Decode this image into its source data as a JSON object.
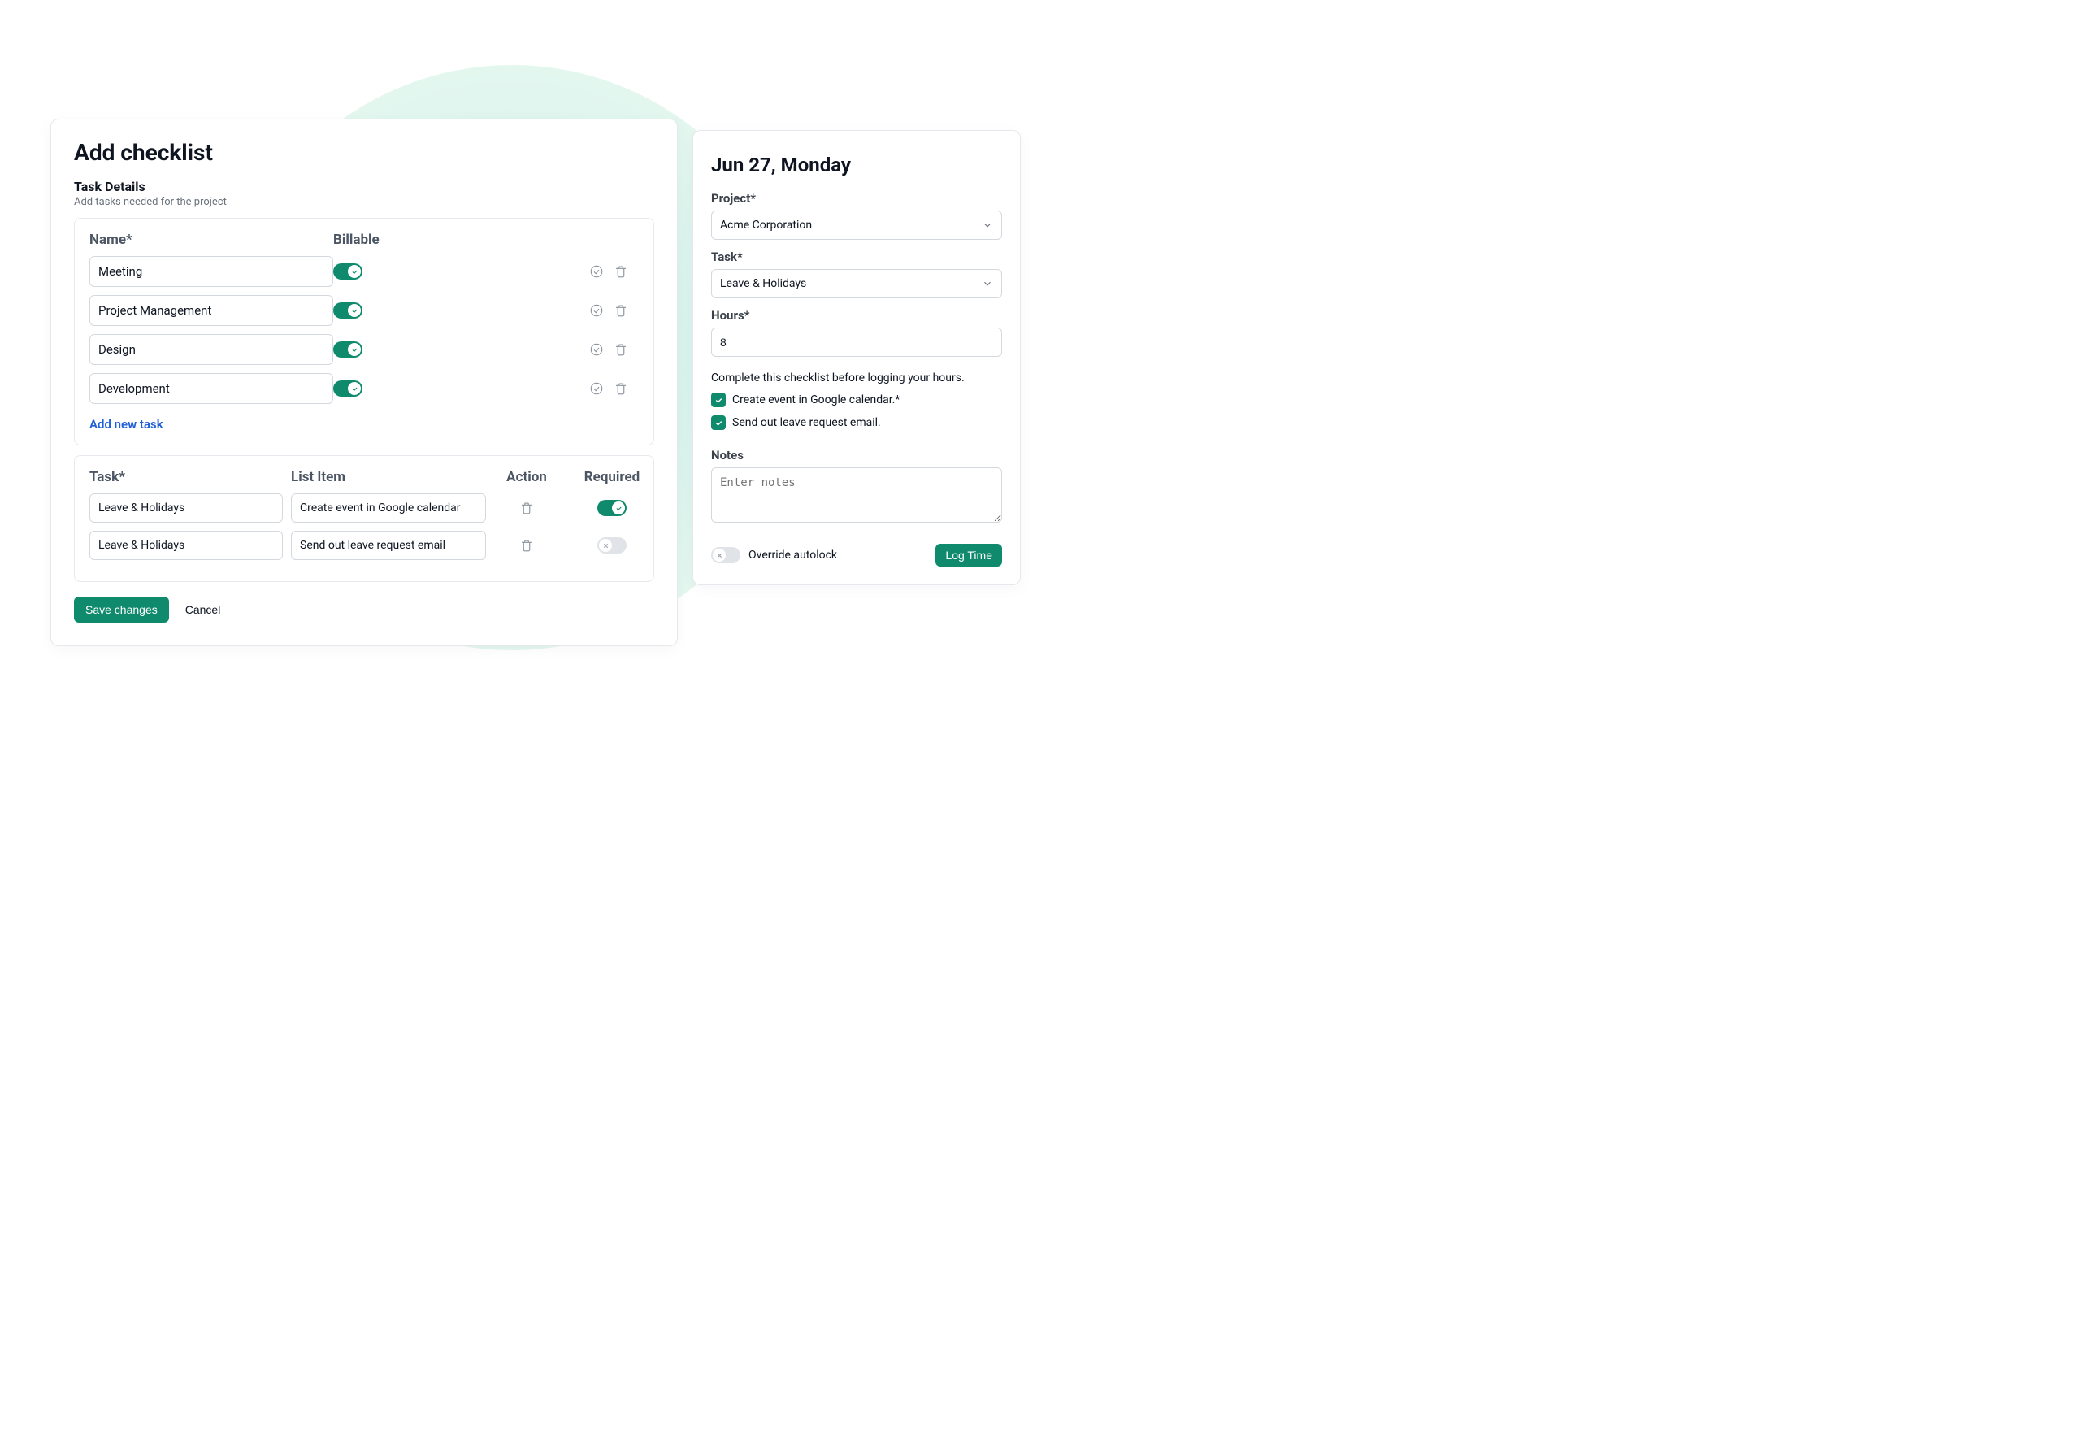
{
  "left": {
    "title": "Add checklist",
    "subtitle": "Task Details",
    "subtext": "Add tasks needed for the project",
    "columns": {
      "name": "Name*",
      "billable": "Billable"
    },
    "tasks": [
      {
        "name": "Meeting",
        "billable": true
      },
      {
        "name": "Project Management",
        "billable": true
      },
      {
        "name": "Design",
        "billable": true
      },
      {
        "name": "Development",
        "billable": true
      }
    ],
    "add_new": "Add new task",
    "items_columns": {
      "task": "Task*",
      "list_item": "List Item",
      "action": "Action",
      "required": "Required"
    },
    "items": [
      {
        "task": "Leave & Holidays",
        "item": "Create event in Google calendar",
        "required": true
      },
      {
        "task": "Leave & Holidays",
        "item": "Send out leave request email",
        "required": false
      }
    ],
    "save": "Save changes",
    "cancel": "Cancel"
  },
  "right": {
    "title": "Jun 27, Monday",
    "project_label": "Project*",
    "project_value": "Acme Corporation",
    "task_label": "Task*",
    "task_value": "Leave & Holidays",
    "hours_label": "Hours*",
    "hours_value": "8",
    "hint": "Complete this checklist before logging your hours.",
    "checks": [
      "Create event in Google calendar.*",
      "Send out leave request email."
    ],
    "notes_label": "Notes",
    "notes_placeholder": "Enter notes",
    "override_label": "Override autolock",
    "log_time": "Log Time"
  }
}
